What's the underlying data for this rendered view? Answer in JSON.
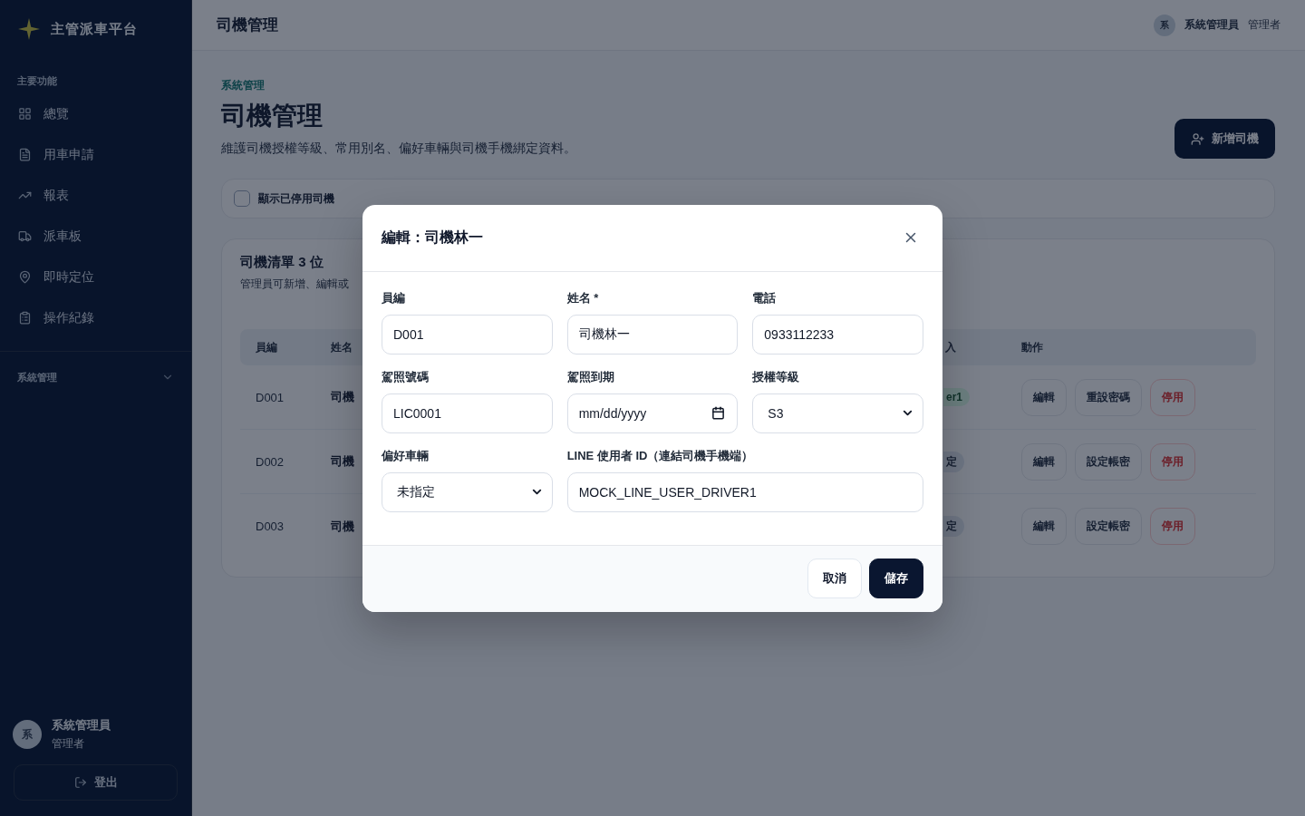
{
  "sidebar": {
    "brand": "主管派車平台",
    "nav_section_title": "主要功能",
    "nav_items": [
      {
        "label": "總覽",
        "selected": false
      },
      {
        "label": "用車申請",
        "selected": false
      },
      {
        "label": "報表",
        "selected": false
      },
      {
        "label": "派車板",
        "selected": false
      },
      {
        "label": "即時定位",
        "selected": false
      },
      {
        "label": "操作紀錄",
        "selected": false
      }
    ],
    "admin_section": {
      "title": "系統管理",
      "expanded": false
    },
    "user": {
      "avatar_initial": "系",
      "name": "系統管理員",
      "role": "管理者"
    },
    "logout_button": "登出"
  },
  "header": {
    "title": "司機管理",
    "user": {
      "avatar_initial": "系",
      "name": "系統管理員",
      "role": "管理者"
    }
  },
  "page": {
    "breadcrumb": "系統管理",
    "title": "司機管理",
    "subtitle": "維護司機授權等級、常用別名、偏好車輛與司機手機綁定資料。",
    "add_button": "新增司機"
  },
  "filter": {
    "label": "顯示已停用司機",
    "checked": false
  },
  "driver_list": {
    "title": "司機清單 3 位",
    "subtitle": "管理員可新增、編輯或",
    "columns": [
      "員編",
      "姓名",
      "入",
      "動作"
    ],
    "rows": [
      {
        "id": "D001",
        "name": "司機",
        "column_3": {
          "text": "er1",
          "kind": "success"
        },
        "actions": [
          {
            "label": "編輯",
            "kind": "default"
          },
          {
            "label": "重設密碼",
            "kind": "default"
          },
          {
            "label": "停用",
            "kind": "danger"
          }
        ]
      },
      {
        "id": "D002",
        "name": "司機",
        "column_3": {
          "text": "定",
          "kind": "neutral"
        },
        "actions": [
          {
            "label": "編輯",
            "kind": "default"
          },
          {
            "label": "設定帳密",
            "kind": "default"
          },
          {
            "label": "停用",
            "kind": "danger"
          }
        ]
      },
      {
        "id": "D003",
        "name": "司機",
        "column_3": {
          "text": "定",
          "kind": "neutral"
        },
        "actions": [
          {
            "label": "編輯",
            "kind": "default"
          },
          {
            "label": "設定帳密",
            "kind": "default"
          },
          {
            "label": "停用",
            "kind": "danger"
          }
        ]
      }
    ]
  },
  "edit_dialog": {
    "title": "編輯：司機林一",
    "fields": [
      {
        "kind": "text",
        "label": "員編",
        "value": "D001"
      },
      {
        "kind": "text",
        "label": "姓名 *",
        "value": "司機林一"
      },
      {
        "kind": "text",
        "label": "電話",
        "value": "0933112233"
      },
      {
        "kind": "text",
        "label": "駕照號碼",
        "value": "LIC0001"
      },
      {
        "kind": "date",
        "label": "駕照到期",
        "placeholder": "mm/dd/yyyy"
      },
      {
        "kind": "select",
        "label": "授權等級",
        "value": "S3"
      },
      {
        "kind": "select",
        "label": "偏好車輛",
        "value": "未指定"
      },
      {
        "kind": "wide_text",
        "label": "LINE 使用者 ID（連結司機手機端）",
        "value": "MOCK_LINE_USER_DRIVER1"
      }
    ],
    "buttons": [
      {
        "label": "取消",
        "kind": "secondary"
      },
      {
        "label": "儲存",
        "kind": "primary"
      }
    ]
  }
}
